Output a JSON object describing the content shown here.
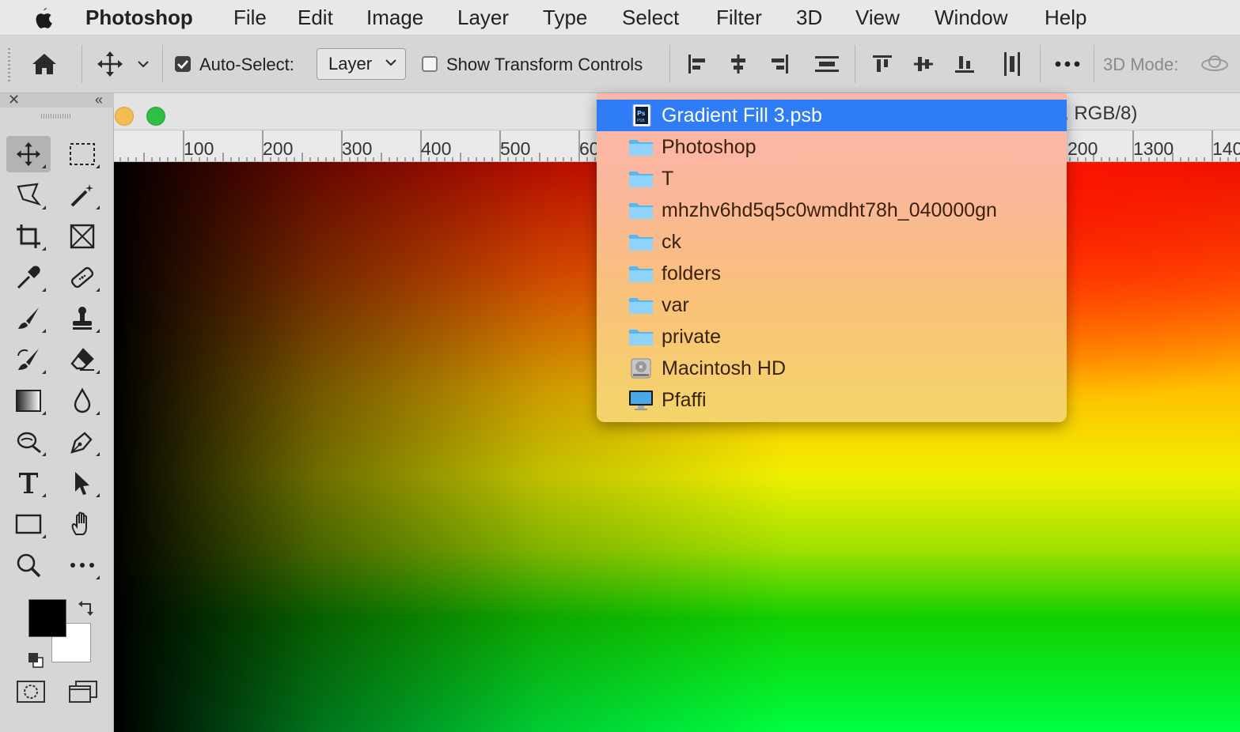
{
  "menubar": {
    "app_name": "Photoshop",
    "items": [
      "File",
      "Edit",
      "Image",
      "Layer",
      "Type",
      "Select",
      "Filter",
      "3D",
      "View",
      "Window",
      "Help"
    ]
  },
  "options_bar": {
    "auto_select_label": "Auto-Select:",
    "auto_select_checked": true,
    "auto_select_target": "Layer",
    "show_transform_label": "Show Transform Controls",
    "show_transform_checked": false,
    "mode_3d_label": "3D Mode:"
  },
  "document": {
    "title_suffix": ", RGB/8)",
    "ruler_labels_left": [
      "100",
      "200",
      "300",
      "400",
      "500",
      "60"
    ],
    "ruler_labels_right": [
      "200",
      "1300",
      "140"
    ]
  },
  "path_popup": {
    "items": [
      {
        "label": "Gradient Fill 3.psb",
        "icon": "psb-file-icon",
        "selected": true
      },
      {
        "label": "Photoshop",
        "icon": "folder-icon",
        "selected": false
      },
      {
        "label": "T",
        "icon": "folder-icon",
        "selected": false
      },
      {
        "label": "mhzhv6hd5q5c0wmdht78h_040000gn",
        "icon": "folder-icon",
        "selected": false
      },
      {
        "label": "ck",
        "icon": "folder-icon",
        "selected": false
      },
      {
        "label": "folders",
        "icon": "folder-icon",
        "selected": false
      },
      {
        "label": "var",
        "icon": "folder-icon",
        "selected": false
      },
      {
        "label": "private",
        "icon": "folder-icon",
        "selected": false
      },
      {
        "label": "Macintosh HD",
        "icon": "hard-drive-icon",
        "selected": false
      },
      {
        "label": "Pfaffi",
        "icon": "computer-icon",
        "selected": false
      }
    ]
  },
  "colors": {
    "selection": "#2e7cf6",
    "foreground": "#000000",
    "background": "#ffffff",
    "window_yellow": "#f5bd4f",
    "window_green": "#2fbf44"
  }
}
